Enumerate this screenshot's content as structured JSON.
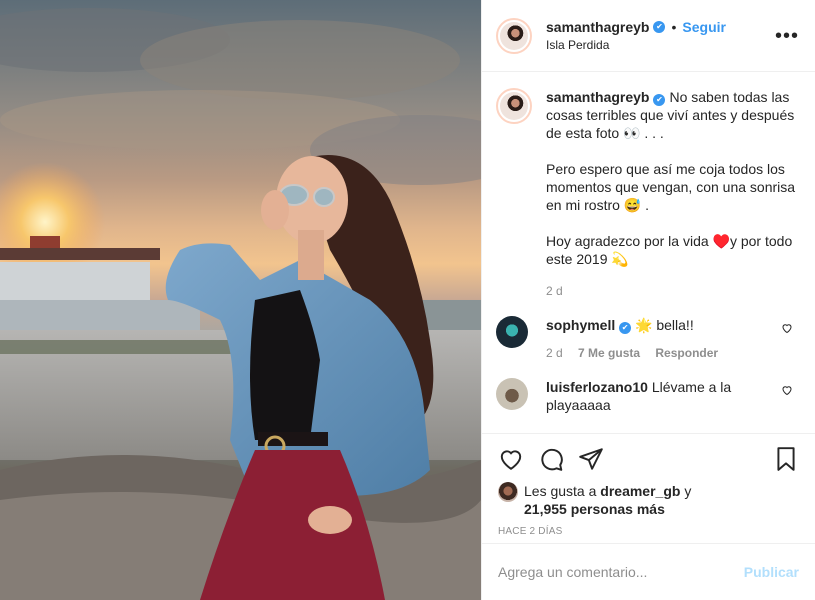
{
  "colors": {
    "link": "#3897f0",
    "muted": "#8e8e8e",
    "text": "#262626",
    "publish_disabled": "#b2dffc"
  },
  "header": {
    "username": "samanthagreyb",
    "separator": "•",
    "follow_label": "Seguir",
    "location": "Isla Perdida",
    "more_icon": "more-options-icon"
  },
  "caption": {
    "username": "samanthagreyb",
    "text": "No saben todas las cosas terribles que viví antes y después de esta foto 👀 . . .",
    "paragraph2": "Pero espero que así me coja todos los momentos que vengan, con una sonrisa en mi rostro 😅 .",
    "paragraph3": "Hoy agradezco por la vida ♥️y por todo este 2019 💫",
    "time": "2 d"
  },
  "comments": [
    {
      "username": "sophymell",
      "text": "🌟 bella!!",
      "time": "2 d",
      "likes": "7 Me gusta",
      "reply": "Responder"
    },
    {
      "username": "luisferlozano10",
      "text": "Llévame a la playaaaaa"
    }
  ],
  "likes": {
    "prefix": "Les gusta a",
    "user": "dreamer_gb",
    "connector": "y",
    "count": "21,955 personas más"
  },
  "date": "HACE 2 DÍAS",
  "add_comment": {
    "placeholder": "Agrega un comentario...",
    "publish_label": "Publicar"
  }
}
